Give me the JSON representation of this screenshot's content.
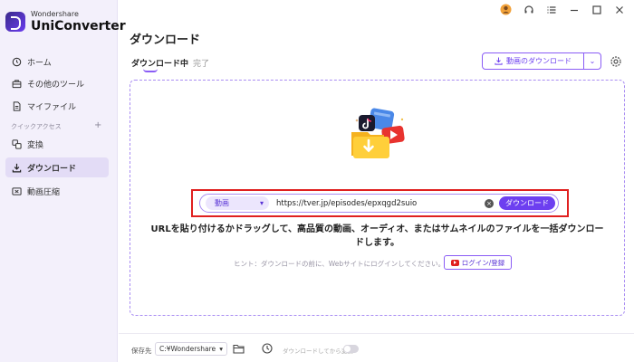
{
  "app": {
    "brand_small": "Wondershare",
    "brand_name": "UniConverter"
  },
  "sidebar": {
    "items": [
      {
        "label": "ホーム",
        "icon": "home-icon"
      },
      {
        "label": "その他のツール",
        "icon": "toolbox-icon"
      },
      {
        "label": "マイファイル",
        "icon": "file-icon"
      }
    ],
    "quick_access_label": "クイックアクセス",
    "quick_access_add": "+",
    "quick_items": [
      {
        "label": "変換",
        "icon": "convert-icon"
      },
      {
        "label": "ダウンロード",
        "icon": "download-icon",
        "active": true
      },
      {
        "label": "動画圧縮",
        "icon": "compress-icon"
      }
    ]
  },
  "header": {
    "title": "ダウンロード",
    "tabs": [
      {
        "label": "ダウンロード中",
        "active": true
      },
      {
        "label": "完了",
        "active": false
      }
    ],
    "download_button": "動画のダウンロード",
    "download_caret": "⌄"
  },
  "titlebar": {
    "icons": [
      "user-icon",
      "headset-icon",
      "menu-icon",
      "minimize-icon",
      "maximize-icon",
      "close-icon"
    ]
  },
  "url_bar": {
    "type_label": "動画",
    "type_caret": "▾",
    "url_value": "https://tver.jp/episodes/epxqgd2suio",
    "clear_glyph": "×",
    "download_label": "ダウンロード"
  },
  "instruction": "URLを貼り付けるかドラッグして、高品質の動画、オーディオ、またはサムネイルのファイルを一括ダウンロードします。",
  "hint": "ヒント：ダウンロードの前に、Webサイトにログインしてください。",
  "login_label": "ログイン/登録",
  "footer": {
    "save_label": "保存先",
    "save_path": "C:¥Wondershare",
    "save_caret": "▾",
    "convert_after_label": "ダウンロードしてから変換",
    "convert_after_enabled": false
  },
  "colors": {
    "accent": "#6d3ff0",
    "highlight_frame": "#e0201f",
    "sidebar_bg": "#f3f0fb"
  }
}
